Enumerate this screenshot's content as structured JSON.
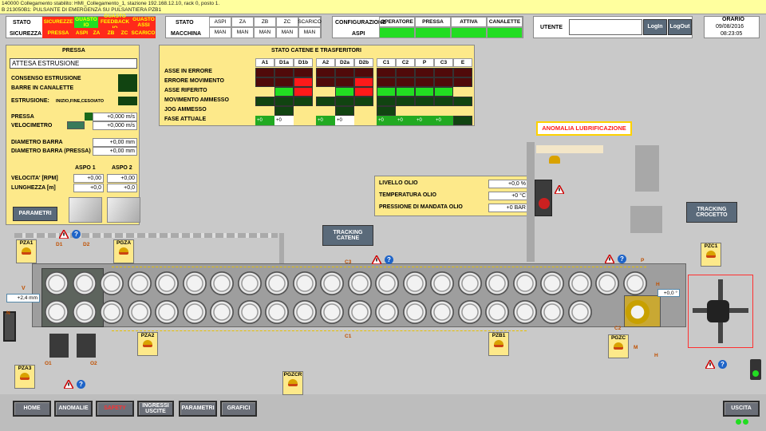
{
  "alarms": [
    "140000  Collegamento stabilito: HMI_Collegamento_1, stazione 192.168.12.10, rack 0, posto 1.",
    "B  213050B1: PULSANTE DI EMERGENZA SU PULSANTIERA PZB1"
  ],
  "stato": {
    "l1": "STATO",
    "l2": "SICUREZZA",
    "cells": [
      {
        "t": "SICUREZZE",
        "b": "PRESSA"
      },
      {
        "t": "GUASTO IO",
        "b": "ASPI"
      },
      {
        "t": "GUASTO FEEDBACK IO",
        "b": "ZA"
      },
      {
        "t": "GUASTO ASSI",
        "b": "ZB"
      }
    ],
    "extra": [
      "ZC",
      "SCARICO"
    ]
  },
  "macchina": {
    "l1": "STATO",
    "l2": "MACCHINA",
    "heads": [
      "ASPI",
      "ZA",
      "ZB",
      "ZC",
      "SCARICO"
    ],
    "vals": [
      "MAN",
      "MAN",
      "MAN",
      "MAN",
      "MAN"
    ]
  },
  "config": {
    "l1": "CONFIGURAZIONE",
    "l2": "ASPI",
    "heads": [
      "OPERATORE",
      "PRESSA",
      "ATTIVA",
      "CANALETTE"
    ]
  },
  "user": {
    "label": "UTENTE",
    "login": "LogIn",
    "logout": "LogOut"
  },
  "clock": {
    "label": "ORARIO",
    "date": "09/08/2016",
    "time": "08:23:05"
  },
  "pressa": {
    "title": "PRESSA",
    "status": "ATTESA ESTRUSIONE",
    "rows": [
      "CONSENSO ESTRUSIONE",
      "BARRE IN CANALETTE"
    ],
    "estr": "ESTRUSIONE:",
    "estr_sub": "INIZIO,FINE,CESOIATO",
    "pressa_lbl": "PRESSA",
    "pressa_val": "+0,000 m/s",
    "velo_lbl": "VELOCIMETRO",
    "velo_val": "+0,000 m/s",
    "diam1": "DIAMETRO BARRA",
    "diam1_val": "+0,00 mm",
    "diam2": "DIAMETRO BARRA (PRESSA)",
    "diam2_val": "+0,00 mm",
    "aspo1": "ASPO 1",
    "aspo2": "ASPO 2",
    "vel": "VELOCITA' [RPM]",
    "vel1": "+0,00",
    "vel2": "+0,00",
    "lung": "LUNGHEZZA [m]",
    "lung1": "+0,0",
    "lung2": "+0,0",
    "btn": "PARAMETRI"
  },
  "catene": {
    "title": "STATO CATENE E TRASFERITORI",
    "cols": [
      "A1",
      "D1a",
      "D1b",
      "A2",
      "D2a",
      "D2b",
      "C1",
      "C2",
      "P",
      "C3",
      "E"
    ],
    "rows": [
      "ASSE IN ERRORE",
      "ERRORE MOVIMENTO",
      "ASSE RIFERITO",
      "MOVIMENTO AMMESSO",
      "JOG AMMESSO",
      "FASE ATTUALE"
    ],
    "fase": [
      "+0",
      "+0",
      "",
      "+0",
      "+0",
      "",
      "+0",
      "+0",
      "+0",
      "+0",
      ""
    ]
  },
  "olio": {
    "rows": [
      {
        "l": "LIVELLO OLIO",
        "v": "+0,0 %"
      },
      {
        "l": "TEMPERATURA OLIO",
        "v": "+0 °C"
      },
      {
        "l": "PRESSIONE DI MANDATA OLIO",
        "v": "+0 BAR"
      }
    ]
  },
  "anomalia": "ANOMALIA LUBRIFICAZIONE",
  "tracking_catene": "TRACKING CATENE",
  "tracking_crocetto": "TRACKING CROCETTO",
  "plant": {
    "v_label": "V",
    "v_val": "+2,4 mm",
    "h_val": "+0,0 °",
    "labels": [
      "D1",
      "D2",
      "C3",
      "C1",
      "C2",
      "O1",
      "O2",
      "P",
      "H",
      "N",
      "M",
      "H"
    ]
  },
  "stations": [
    "PZA1",
    "PGZA",
    "PZA2",
    "PZA3",
    "PGZCR",
    "PZB1",
    "PGZC",
    "PZC1"
  ],
  "nav": [
    "HOME",
    "ANOMALIE",
    "SAFETY",
    "INGRESSI USCITE",
    "PARAMETRI",
    "GRAFICI"
  ],
  "exit": "USCITA",
  "colors": {
    "accent": "#fde98a",
    "red": "#ff2a1a",
    "green": "#22dd22"
  }
}
